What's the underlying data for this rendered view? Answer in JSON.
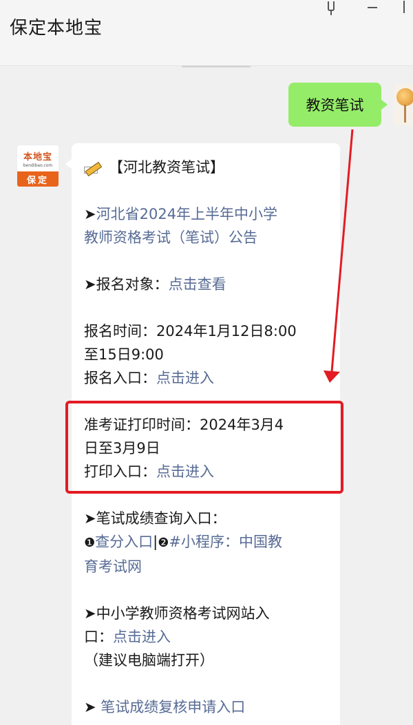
{
  "window": {
    "title": "保定本地宝"
  },
  "outgoing_message": "教资笔试",
  "bot_avatar": {
    "logo_text": "本地宝",
    "logo_sub": "bendibao.com",
    "band_text": "保定"
  },
  "message": {
    "header": "【河北教资笔试】",
    "announcement_arrow": "➤",
    "announcement_line1": "河北省2024年上半年中小学",
    "announcement_line2": "教师资格考试（笔试）公告",
    "target_prefix": "➤报名对象：",
    "target_link": "点击查看",
    "reg_time_line1": "报名时间：2024年1月12日8:00",
    "reg_time_line2": "至15日9:00",
    "reg_entry_prefix": "报名入口：",
    "reg_entry_link": "点击进入",
    "admit_line1": "准考证打印时间：2024年3月4",
    "admit_line2": "日至3月9日",
    "print_prefix": "打印入口：",
    "print_link": "点击进入",
    "score_title": "➤笔试成绩查询入口：",
    "score_num1": "❶",
    "score_link1": "查分入口",
    "score_sep": "|",
    "score_num2": "❷",
    "score_link2_line1": "#小程序：中国教",
    "score_link2_line2": "育考试网",
    "site_line1": "➤中小学教师资格考试网站入",
    "site_prefix": "口：",
    "site_link": "点击进入",
    "site_note": "（建议电脑端打开）",
    "review_arrow": "➤ ",
    "review_link": "笔试成绩复核申请入口"
  },
  "colors": {
    "link": "#576b95",
    "outgoing_bubble": "#95ec69",
    "annotation_red": "#e31b23"
  }
}
